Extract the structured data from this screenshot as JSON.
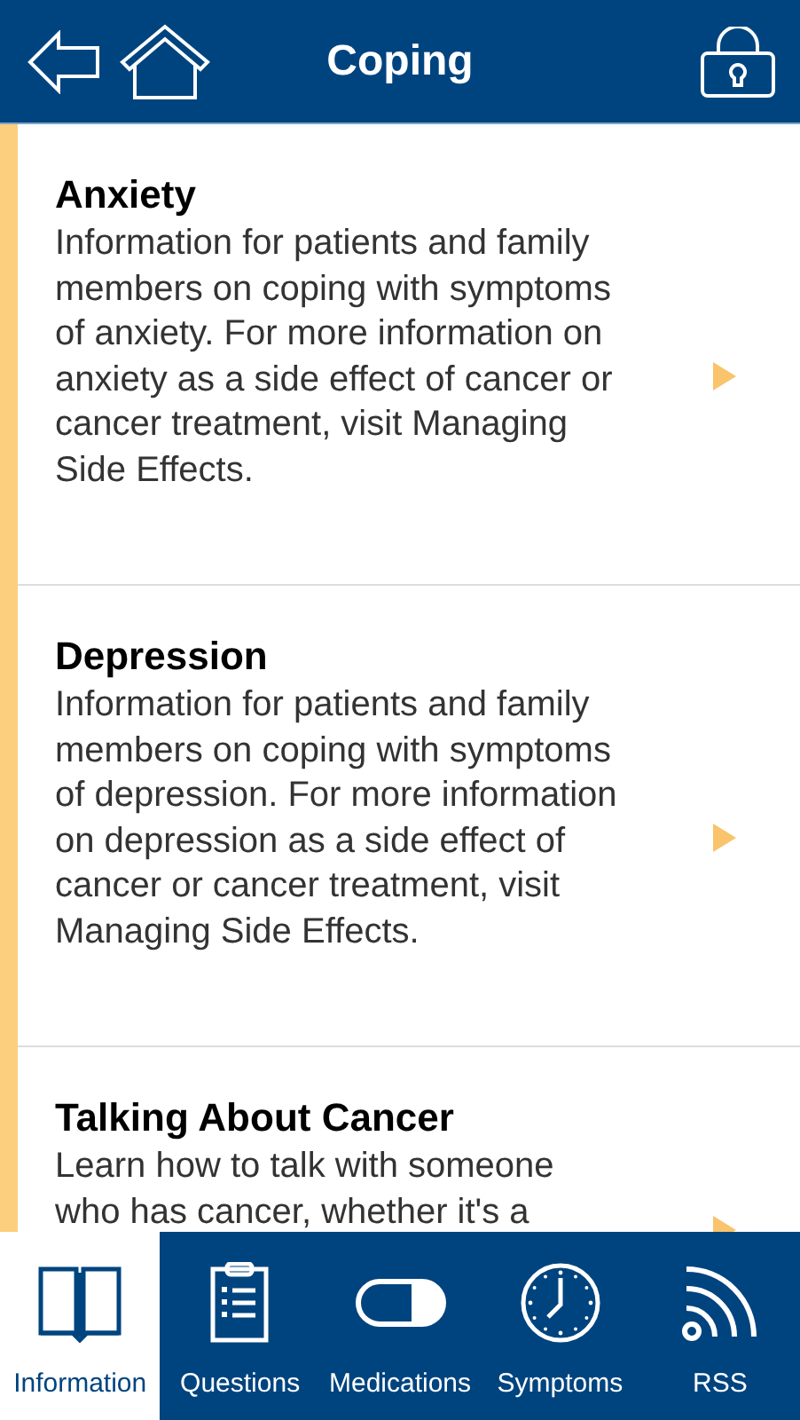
{
  "header": {
    "title": "Coping"
  },
  "items": [
    {
      "title": "Anxiety",
      "description": "Information for patients and family members on coping with symptoms of anxiety. For more information on anxiety as a side effect of cancer or cancer treatment, visit Managing Side Effects."
    },
    {
      "title": "Depression",
      "description": "Information for patients and family members on coping with symptoms of depression. For more information on depression as a side effect of cancer or cancer treatment, visit Managing Side Effects."
    },
    {
      "title": "Talking About Cancer",
      "description": "Learn how to talk with someone who has cancer, whether it's a"
    }
  ],
  "tabs": [
    {
      "label": "Information",
      "kind": "book",
      "selected": true
    },
    {
      "label": "Questions",
      "kind": "clipboard",
      "selected": false
    },
    {
      "label": "Medications",
      "kind": "pill",
      "selected": false
    },
    {
      "label": "Symptoms",
      "kind": "clock",
      "selected": false
    },
    {
      "label": "RSS",
      "kind": "rss",
      "selected": false
    }
  ]
}
